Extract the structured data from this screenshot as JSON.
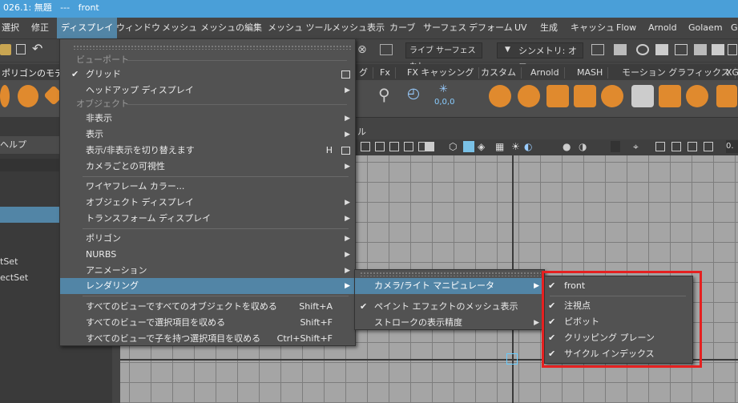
{
  "window": {
    "title": "026.1: 無題   ---   front"
  },
  "menubar": [
    {
      "label": "選択"
    },
    {
      "label": "修正"
    },
    {
      "label": "ディスプレイ"
    },
    {
      "label": "ウィンドウ"
    },
    {
      "label": "メッシュ"
    },
    {
      "label": "メッシュの編集"
    },
    {
      "label": "メッシュ ツール"
    },
    {
      "label": "メッシュ表示"
    },
    {
      "label": "カーブ"
    },
    {
      "label": "サーフェス"
    },
    {
      "label": "デフォーム"
    },
    {
      "label": "UV"
    },
    {
      "label": "生成"
    },
    {
      "label": "キャッシュ"
    },
    {
      "label": "Flow"
    },
    {
      "label": "Arnold"
    },
    {
      "label": "Golaem"
    },
    {
      "label": "G"
    }
  ],
  "toolbar": {
    "mode_menu": "ポリゴンのモデリ",
    "live_surface": "ライブ サーフェスなし",
    "symmetry": "シンメトリ: オフ"
  },
  "shelf_tabs": [
    {
      "label": "グ"
    },
    {
      "label": "Fx"
    },
    {
      "label": "FX キャッシング"
    },
    {
      "label": "カスタム"
    },
    {
      "label": "Arnold"
    },
    {
      "label": "MASH"
    },
    {
      "label": "モーション グラフィックス"
    },
    {
      "label": "XG"
    }
  ],
  "shelf_coord": "0,0,0",
  "left_panel": {
    "help": "ヘルプ",
    "set1": "tSet",
    "set2": "ectSet"
  },
  "panel_label": "ル",
  "view_value": "0.",
  "display_menu": {
    "sec_viewport": "ビューポート",
    "grid": "グリッド",
    "hud": "ヘッドアップ ディスプレイ",
    "sec_object": "オブジェクト",
    "hide": "非表示",
    "show": "表示",
    "toggle": "表示/非表示を切り替えます",
    "toggle_shortcut": "H",
    "camera_vis": "カメラごとの可視性",
    "wire_color": "ワイヤフレーム カラー...",
    "object_display": "オブジェクト ディスプレイ",
    "transform_display": "トランスフォーム ディスプレイ",
    "polygon": "ポリゴン",
    "nurbs": "NURBS",
    "animation": "アニメーション",
    "rendering": "レンダリング",
    "frame_all": "すべてのビューですべてのオブジェクトを収める",
    "frame_all_shortcut": "Shift+A",
    "frame_sel": "すべてのビューで選択項目を収める",
    "frame_sel_shortcut": "Shift+F",
    "frame_children": "すべてのビューで子を持つ選択項目を収める",
    "frame_children_shortcut": "Ctrl+Shift+F"
  },
  "render_menu": {
    "cam_manip": "カメラ/ライト マニピュレータ",
    "paint_fx": "ペイント エフェクトのメッシュ表示",
    "stroke": "ストロークの表示精度"
  },
  "manip_menu": {
    "front": "front",
    "poi": "注視点",
    "pivot": "ピボット",
    "clip": "クリッピング プレーン",
    "cycle": "サイクル インデックス"
  },
  "colors": {
    "highlight": "#5285a6",
    "titlebar": "#4a9fd8",
    "annotation": "#e52020",
    "shelf_orange": "#e08a2e"
  }
}
